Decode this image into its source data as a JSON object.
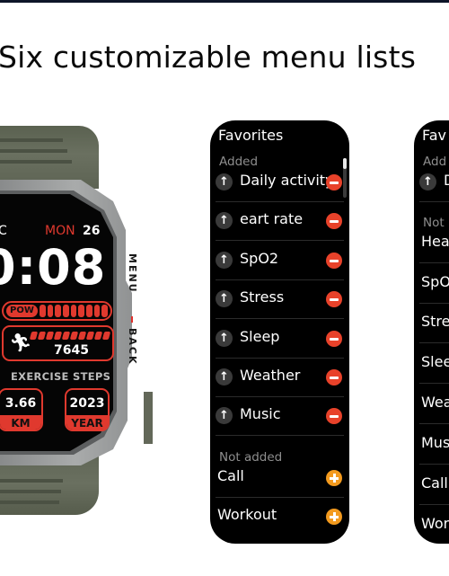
{
  "headline": "Six customizable menu lists",
  "watch": {
    "partial_label": "C",
    "day": "MON",
    "date": "26",
    "time": "0:08",
    "power_label": "POW",
    "power_level": 1.0,
    "steps_value": "7645",
    "steps_progress": 1.0,
    "runner_icon": "running-person-icon",
    "exercise_label": "EXERCISE STEPS",
    "distance_value": "3.66",
    "distance_unit": "KM",
    "year_value": "2023",
    "year_unit": "YEAR",
    "side_label_top": "MENU",
    "side_label_bottom": "BACK",
    "colors": {
      "accent": "#e0392e",
      "strap": "#656b5b",
      "case": "#9a9c9c"
    }
  },
  "panels": [
    {
      "title": "Favorites",
      "added_label": "Added",
      "not_added_label": "Not added",
      "scroll_position": 0.0,
      "added": [
        {
          "label": "Daily activity"
        },
        {
          "label": "eart rate"
        },
        {
          "label": "SpO2"
        },
        {
          "label": "Stress"
        },
        {
          "label": "Sleep"
        },
        {
          "label": "Weather"
        },
        {
          "label": "Music"
        }
      ],
      "not_added": [
        {
          "label": "Call"
        },
        {
          "label": "Workout"
        }
      ]
    },
    {
      "title": "Fav",
      "added_label": "Add",
      "not_added_label": "Not",
      "added": [
        {
          "label": "D"
        }
      ],
      "not_added": [
        {
          "label": "Hea"
        },
        {
          "label": "SpO"
        },
        {
          "label": "Stre"
        },
        {
          "label": "Slee"
        },
        {
          "label": "Wea"
        },
        {
          "label": "Mus"
        },
        {
          "label": "Call"
        },
        {
          "label": "Wor"
        }
      ]
    }
  ],
  "icons": {
    "move_up": "↑",
    "remove": "remove-circle-icon",
    "add": "add-circle-icon"
  },
  "colors": {
    "remove": "#e8422a",
    "add": "#f39a1e",
    "panel_bg": "#000000",
    "top_bar": "#0d1528"
  }
}
